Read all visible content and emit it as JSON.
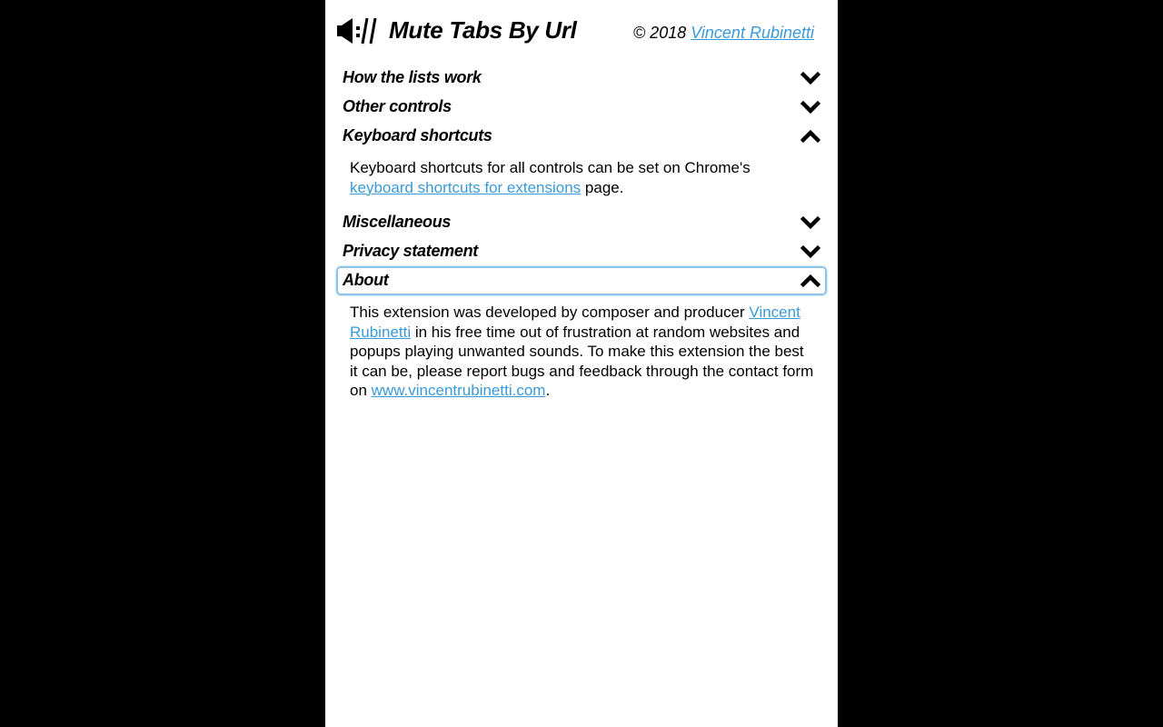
{
  "header": {
    "logo_icon": "muted-speaker-url-icon",
    "title": "Mute Tabs By Url",
    "copyright_prefix": "© 2018 ",
    "copyright_link": "Vincent Rubinetti"
  },
  "colors": {
    "link": "#3a9ad9",
    "focus_border": "#8cc3ea",
    "background": "#ffffff",
    "outer_background": "#000000"
  },
  "sections": [
    {
      "title": "How the lists work",
      "expanded": false,
      "icon": "chevron-down-icon"
    },
    {
      "title": "Other controls",
      "expanded": false,
      "icon": "chevron-down-icon"
    },
    {
      "title": "Keyboard shortcuts",
      "expanded": true,
      "icon": "chevron-up-icon",
      "body": {
        "text1": "Keyboard shortcuts for all controls can be set on Chrome's ",
        "link": "keyboard shortcuts for extensions",
        "text2": " page."
      }
    },
    {
      "title": "Miscellaneous",
      "expanded": false,
      "icon": "chevron-down-icon"
    },
    {
      "title": "Privacy statement",
      "expanded": false,
      "icon": "chevron-down-icon"
    },
    {
      "title": "About",
      "expanded": true,
      "focused": true,
      "icon": "chevron-up-icon",
      "body": {
        "text1": "This extension was developed by composer and producer ",
        "link1": "Vincent Rubinetti",
        "text2": " in his free time out of frustration at random websites and popups playing unwanted sounds. To make this extension the best it can be, please report bugs and feedback through the contact form on ",
        "link2": "www.vincentrubinetti.com",
        "text3": "."
      }
    }
  ]
}
